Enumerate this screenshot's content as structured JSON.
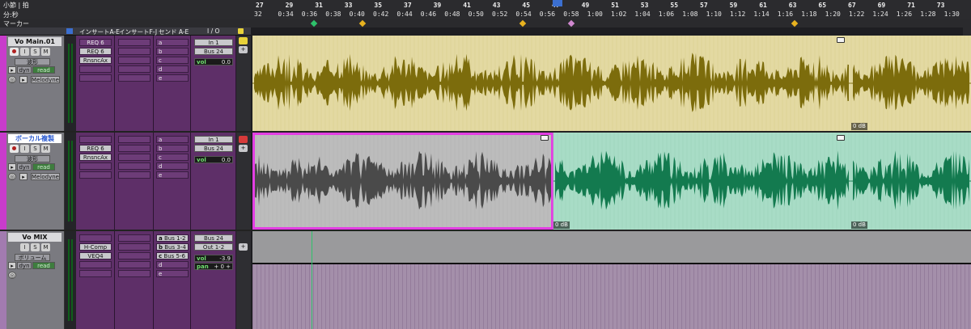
{
  "ruler": {
    "rows": {
      "bars": "小節 | 拍",
      "minsec": "分:秒",
      "markers": "マーカー"
    },
    "bars": [
      "27",
      "29",
      "31",
      "33",
      "35",
      "37",
      "39",
      "41",
      "43",
      "45",
      "47",
      "49",
      "51",
      "53",
      "55",
      "57",
      "59",
      "61",
      "63",
      "65",
      "67",
      "69",
      "71",
      "73"
    ],
    "times": [
      "32",
      "0:34",
      "0:36",
      "0:38",
      "0:40",
      "0:42",
      "0:44",
      "0:46",
      "0:48",
      "0:50",
      "0:52",
      "0:54",
      "0:56",
      "0:58",
      "1:00",
      "1:02",
      "1:04",
      "1:06",
      "1:08",
      "1:10",
      "1:12",
      "1:14",
      "1:16",
      "1:18",
      "1:20",
      "1:22",
      "1:24",
      "1:26",
      "1:28",
      "1:30"
    ],
    "markers": [
      {
        "color": "#2ec26b"
      },
      {
        "color": "#e8b21f"
      },
      {
        "color": "#e8b21f"
      },
      {
        "color": "#d088d0"
      },
      {
        "color": "#e8b21f"
      }
    ]
  },
  "columns": {
    "inserts_ae": "インサートA-E",
    "inserts_fj": "インサートF-J",
    "sends_ae": "センド A-E",
    "io": "I / O"
  },
  "tracks": [
    {
      "name": "Vo Main.01",
      "view": "波形",
      "auto_label": "dyn",
      "auto_mode": "read",
      "plugin": "Melodyne",
      "inserts_ae": [
        "REQ 6",
        "RnsncAx",
        "",
        "",
        ""
      ],
      "inserts_fj": [
        "",
        "",
        "",
        "",
        ""
      ],
      "sends": [
        "a",
        "b",
        "c",
        "d",
        "e"
      ],
      "input": "In 1",
      "output": "Bus 24",
      "vol_label": "vol",
      "vol": "0.0",
      "clip_gain": "0 dB",
      "color": "#c9bb6d"
    },
    {
      "name": "ボーカル複製",
      "view": "波形",
      "auto_label": "dyn",
      "auto_mode": "read",
      "plugin": "Melodyne",
      "inserts_ae": [
        "REQ 6",
        "RnsncAx",
        "",
        "",
        ""
      ],
      "inserts_fj": [
        "",
        "",
        "",
        "",
        ""
      ],
      "sends": [
        "a",
        "b",
        "c",
        "d",
        "e"
      ],
      "input": "In 1",
      "output": "Bus 24",
      "vol_label": "vol",
      "vol": "0.0",
      "clip_gain_left": "0 dB",
      "clip_gain_right": "0 dB",
      "color": "#2f8e5e"
    },
    {
      "name": "Vo MIX",
      "view": "ボリューム",
      "auto_label": "dyn",
      "auto_mode": "read",
      "inserts_ae": [
        "",
        "H-Comp",
        "VEQ4",
        "",
        ""
      ],
      "inserts_fj": [
        "",
        "",
        "",
        "",
        ""
      ],
      "sends": [
        "Bus 1-2",
        "Bus 3-4",
        "Bus 5-6",
        "d",
        "e"
      ],
      "send_letters": [
        "a",
        "b",
        "c"
      ],
      "input": "Bus 24",
      "output": "Out 1-2",
      "vol_label": "vol",
      "vol": "-3.9",
      "pan_label": "pan",
      "pan": "+ 0 +",
      "color": "#a890b0"
    }
  ]
}
